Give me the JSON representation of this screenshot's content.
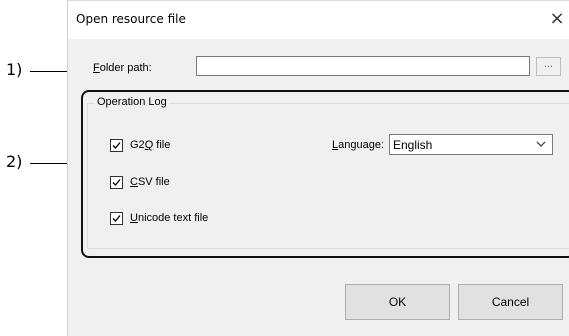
{
  "callouts": {
    "c1": "1)",
    "c2": "2)"
  },
  "dialog": {
    "title": "Open resource file",
    "close_glyph": "×",
    "folder_path": {
      "label_accel": "F",
      "label_rest": "older path:",
      "value": "",
      "browse_label": "..."
    },
    "operation_log": {
      "legend": "Operation Log",
      "g2q": {
        "pre": "G2",
        "accel": "Q",
        "post": " file",
        "checked": true
      },
      "csv": {
        "accel": "C",
        "rest": "SV file",
        "checked": true
      },
      "unicode": {
        "accel": "U",
        "rest": "nicode text file",
        "checked": true
      },
      "language": {
        "label_accel": "L",
        "label_rest": "anguage:",
        "value": "English"
      }
    },
    "ok_label": "OK",
    "cancel_label": "Cancel"
  }
}
